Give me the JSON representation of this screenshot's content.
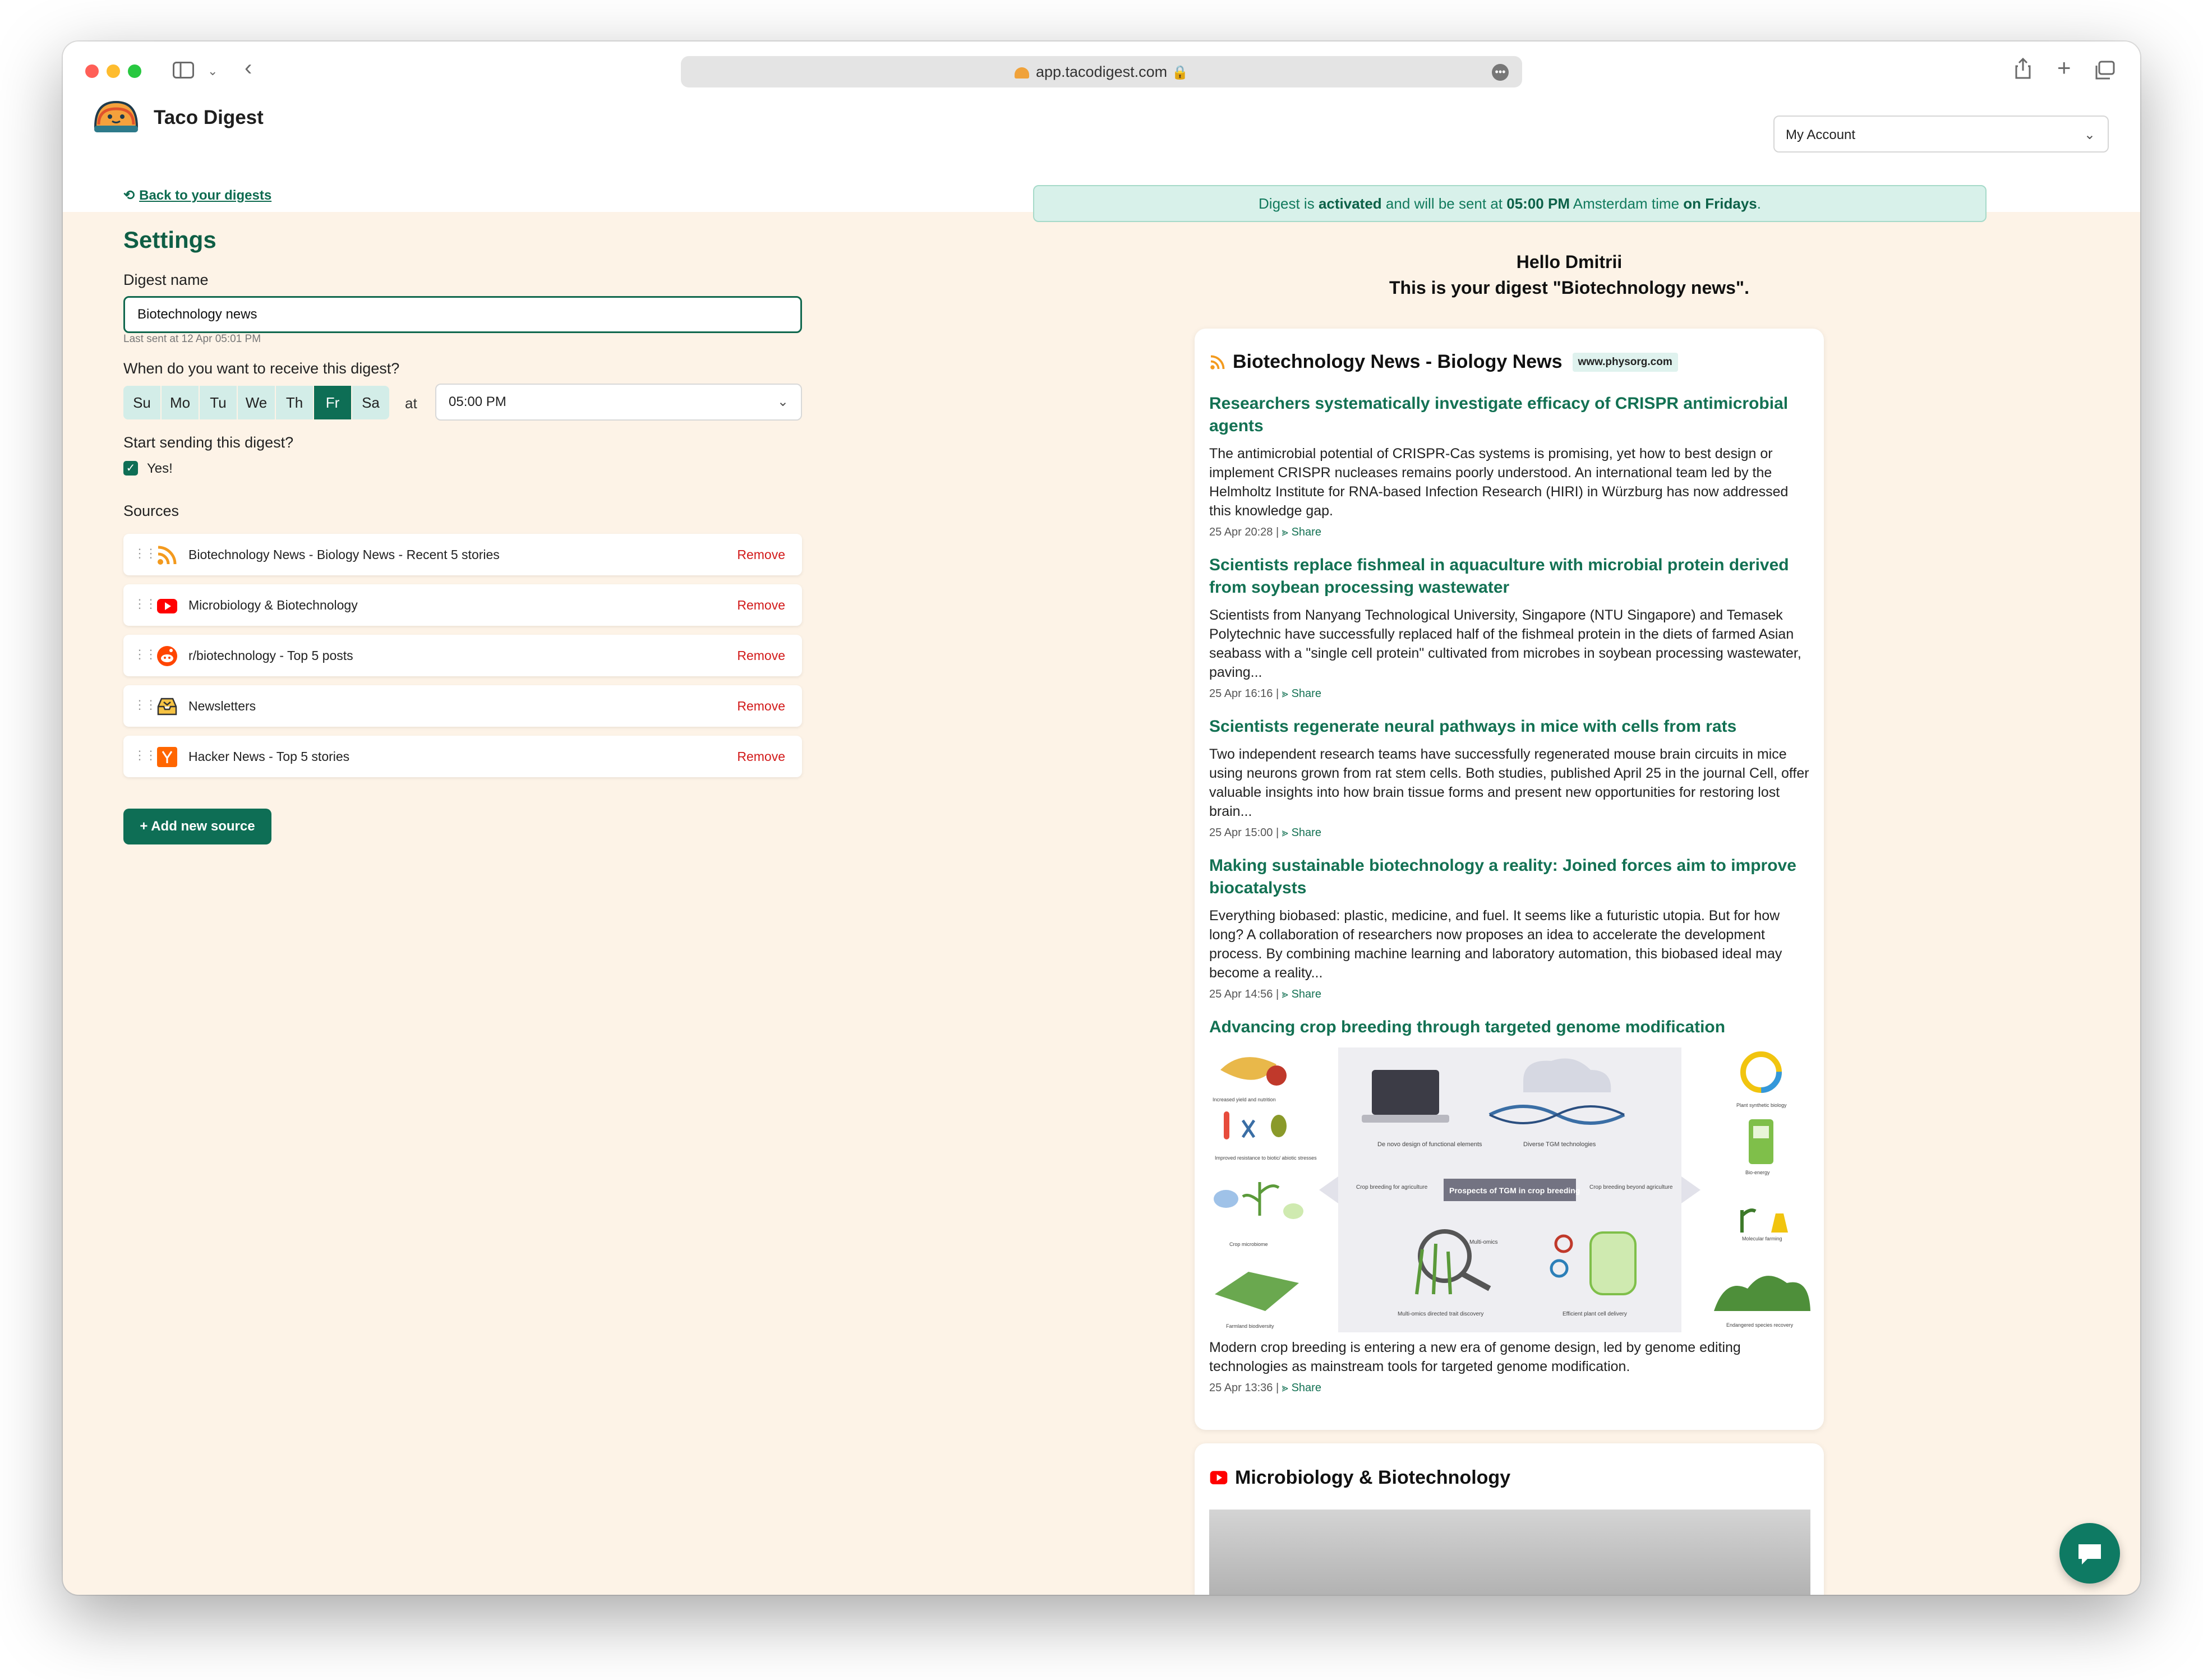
{
  "browser": {
    "url": "app.tacodigest.com",
    "colors": {
      "close": "#ff5f57",
      "minimize": "#febc2e",
      "maximize": "#28c840"
    }
  },
  "app": {
    "brand": "Taco Digest",
    "account_label": "My Account"
  },
  "settings": {
    "back_link": "Back to your digests",
    "title": "Settings",
    "digest_name_label": "Digest name",
    "digest_name_value": "Biotechnology news",
    "last_sent": "Last sent at 12 Apr 05:01 PM",
    "schedule_label": "When do you want to receive this digest?",
    "days": [
      {
        "label": "Su",
        "selected": false
      },
      {
        "label": "Mo",
        "selected": false
      },
      {
        "label": "Tu",
        "selected": false
      },
      {
        "label": "We",
        "selected": false
      },
      {
        "label": "Th",
        "selected": false
      },
      {
        "label": "Fr",
        "selected": true
      },
      {
        "label": "Sa",
        "selected": false
      }
    ],
    "at_label": "at",
    "time_value": "05:00 PM",
    "start_label": "Start sending this digest?",
    "start_checkbox_label": "Yes!",
    "start_checked": true,
    "sources_label": "Sources",
    "sources": [
      {
        "name": "Biotechnology News - Biology News - Recent 5 stories",
        "icon": "rss-icon",
        "remove": "Remove"
      },
      {
        "name": "Microbiology & Biotechnology",
        "icon": "youtube-icon",
        "remove": "Remove"
      },
      {
        "name": "r/biotechnology - Top 5 posts",
        "icon": "reddit-icon",
        "remove": "Remove"
      },
      {
        "name": "Newsletters",
        "icon": "inbox-icon",
        "remove": "Remove"
      },
      {
        "name": "Hacker News - Top 5 stories",
        "icon": "hacker-news-icon",
        "remove": "Remove"
      }
    ],
    "add_source": "+ Add new source"
  },
  "preview": {
    "banner": {
      "p1": "Digest is ",
      "b1": "activated",
      "p2": " and will be sent at ",
      "b2": "05:00 PM",
      "p3": " Amsterdam time ",
      "b3": "on Fridays",
      "p4": "."
    },
    "greeting_line1": "Hello Dmitrii",
    "greeting_line2": "This is your digest \"Biotechnology news\".",
    "feed1": {
      "title": "Biotechnology News - Biology News",
      "domain": "www.physorg.com",
      "articles": [
        {
          "title": "Researchers systematically investigate efficacy of CRISPR antimicrobial agents",
          "desc": "The antimicrobial potential of CRISPR-Cas systems is promising, yet how to best design or implement CRISPR nucleases remains poorly understood. An international team led by the Helmholtz Institute for RNA-based Infection Research (HIRI) in Würzburg has now addressed this knowledge gap.",
          "date": "25 Apr 20:28",
          "share": "Share"
        },
        {
          "title": "Scientists replace fishmeal in aquaculture with microbial protein derived from soybean processing wastewater",
          "desc": "Scientists from Nanyang Technological University, Singapore (NTU Singapore) and Temasek Polytechnic have successfully replaced half of the fishmeal protein in the diets of farmed Asian seabass with a \"single cell protein\" cultivated from microbes in soybean processing wastewater, paving...",
          "date": "25 Apr 16:16",
          "share": "Share"
        },
        {
          "title": "Scientists regenerate neural pathways in mice with cells from rats",
          "desc": "Two independent research teams have successfully regenerated mouse brain circuits in mice using neurons grown from rat stem cells. Both studies, published April 25 in the journal Cell, offer valuable insights into how brain tissue forms and present new opportunities for restoring lost brain...",
          "date": "25 Apr 15:00",
          "share": "Share"
        },
        {
          "title": "Making sustainable biotechnology a reality: Joined forces aim to improve biocatalysts",
          "desc": "Everything biobased: plastic, medicine, and fuel. It seems like a futuristic utopia. But for how long? A collaboration of researchers now proposes an idea to accelerate the development process. By combining machine learning and laboratory automation, this biobased ideal may become a reality...",
          "date": "25 Apr 14:56",
          "share": "Share"
        },
        {
          "title": "Advancing crop breeding through targeted genome modification",
          "desc": "Modern crop breeding is entering a new era of genome design, led by genome editing technologies as mainstream tools for targeted genome modification.",
          "date": "25 Apr 13:36",
          "share": "Share"
        }
      ],
      "figure_labels": {
        "center": "Prospects of TGM in crop breeding",
        "left_arrow": "Crop breeding for agriculture",
        "right_arrow": "Crop breeding beyond agriculture",
        "top_left": "De novo design of functional elements",
        "top_right": "Diverse TGM technologies",
        "bottom_left": "Multi-omics directed trait discovery",
        "bottom_right": "Efficient plant cell delivery",
        "multi_omics": "Multi-omics",
        "l1": "Increased yield and nutrition",
        "l2": "Improved resistance to biotic/ abiotic stresses",
        "l3": "Crop microbiome",
        "l4": "Farmland biodiversity",
        "r1": "Plant synthetic biology",
        "r2": "Bio-energy",
        "r3": "Molecular farming",
        "r4": "Endangered species recovery"
      }
    },
    "feed2": {
      "title": "Microbiology & Biotechnology"
    }
  }
}
